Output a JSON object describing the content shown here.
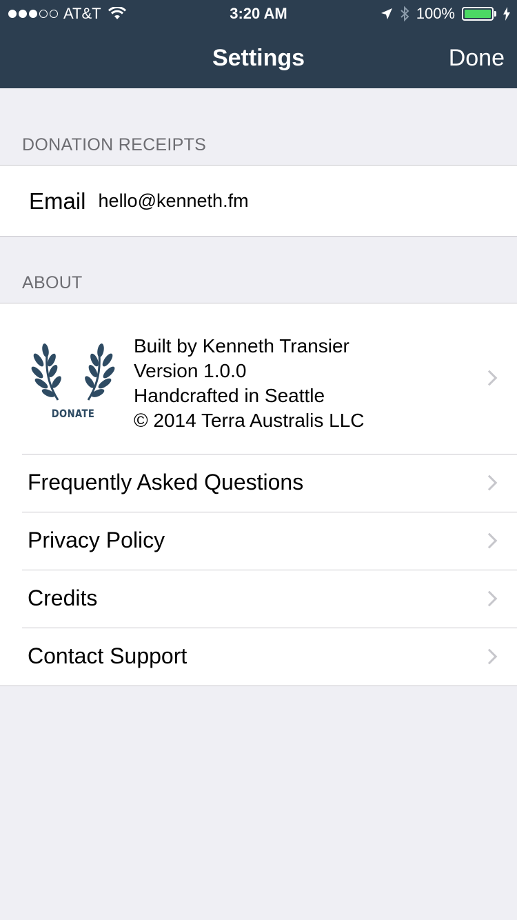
{
  "status_bar": {
    "carrier": "AT&T",
    "time": "3:20 AM",
    "battery": "100%",
    "signal_bars_filled": 3,
    "signal_bars_total": 5
  },
  "nav": {
    "title": "Settings",
    "done_label": "Done"
  },
  "donation_receipts": {
    "header": "DONATION RECEIPTS",
    "email_label": "Email",
    "email_value": "hello@kenneth.fm"
  },
  "about": {
    "header": "ABOUT",
    "logo_text": "DONATE",
    "info_lines": [
      "Built by Kenneth Transier",
      "Version 1.0.0",
      "Handcrafted in Seattle",
      "© 2014 Terra Australis LLC"
    ],
    "items": [
      {
        "label": "Frequently Asked Questions"
      },
      {
        "label": "Privacy Policy"
      },
      {
        "label": "Credits"
      },
      {
        "label": "Contact Support"
      }
    ]
  },
  "colors": {
    "navbar": "#2c3e50",
    "background": "#efeff4",
    "logo": "#2e4b63",
    "battery": "#4cd964"
  }
}
